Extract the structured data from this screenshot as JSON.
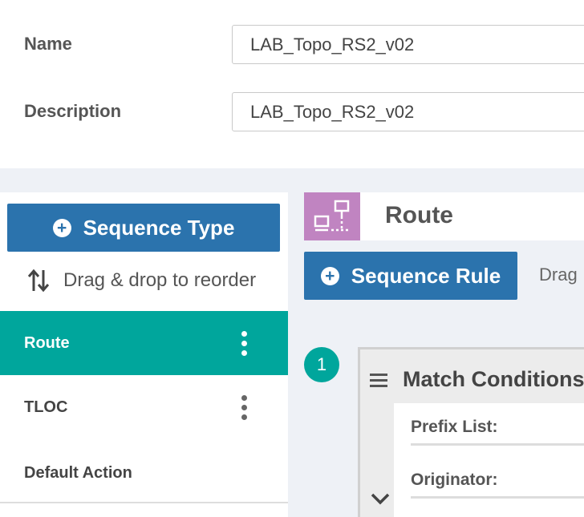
{
  "form": {
    "name_label": "Name",
    "name_value": "LAB_Topo_RS2_v02",
    "description_label": "Description",
    "description_value": "LAB_Topo_RS2_v02"
  },
  "sidebar": {
    "sequence_type_button": "Sequence Type",
    "drag_hint": "Drag & drop to reorder",
    "items": [
      {
        "label": "Route",
        "active": true
      },
      {
        "label": "TLOC",
        "active": false
      },
      {
        "label": "Default Action",
        "active": false
      }
    ]
  },
  "main": {
    "section_title": "Route",
    "sequence_rule_button": "Sequence Rule",
    "drag_text": "Drag",
    "sequence_number": "1",
    "match_conditions_title": "Match Conditions",
    "conditions": [
      {
        "label": "Prefix List:"
      },
      {
        "label": "Originator:"
      }
    ]
  },
  "colors": {
    "primary": "#2b73ad",
    "accent": "#00a69c",
    "route_icon_bg": "#c084c1"
  }
}
